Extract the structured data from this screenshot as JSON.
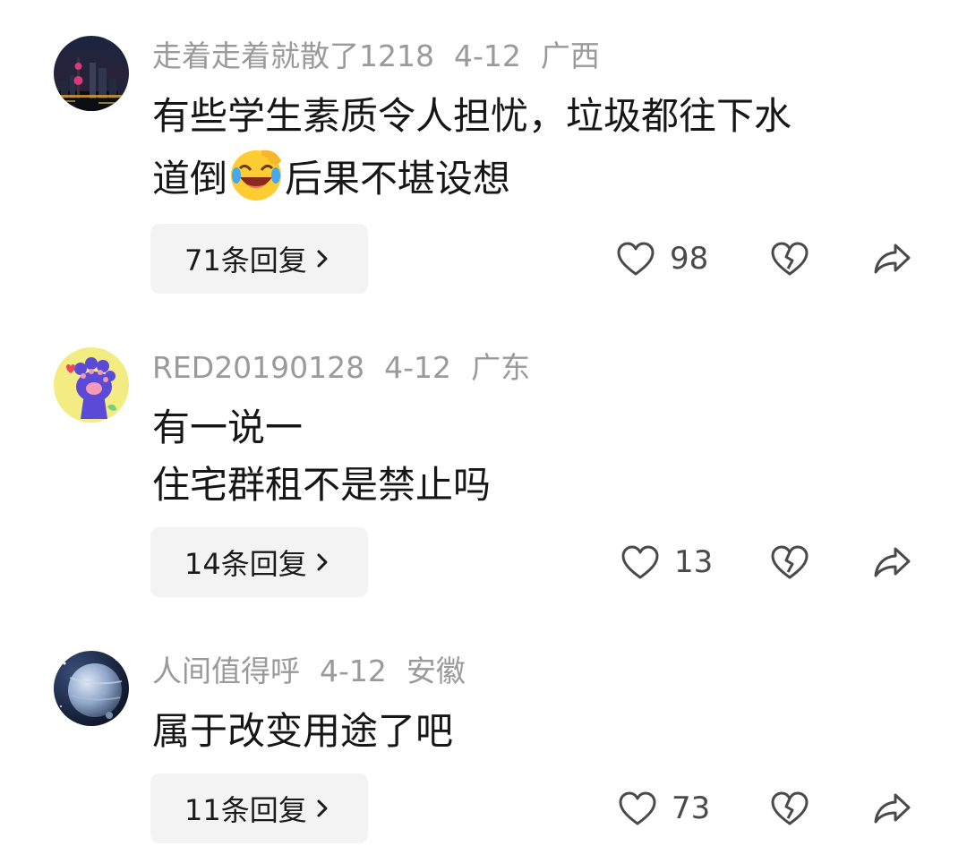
{
  "comments": [
    {
      "username": "走着走着就散了1218",
      "date": "4-12",
      "location": "广西",
      "text_lines": [
        "有些学生素质令人担忧，垃圾都往下水",
        "道倒",
        "后果不堪设想"
      ],
      "replies_label": "71条回复",
      "likes": "98",
      "avatar_icon": "city-night-skyline-avatar",
      "emoji_icon": "laughing-tears-emoji"
    },
    {
      "username": "RED20190128",
      "date": "4-12",
      "location": "广东",
      "text_lines": [
        "有一说一",
        "住宅群租不是禁止吗"
      ],
      "replies_label": "14条回复",
      "likes": "13",
      "avatar_icon": "cat-paw-avatar"
    },
    {
      "username": "人间值得呼",
      "date": "4-12",
      "location": "安徽",
      "text_lines": [
        "属于改变用途了吧"
      ],
      "replies_label": "11条回复",
      "likes": "73",
      "avatar_icon": "planet-space-avatar"
    }
  ],
  "icons": {
    "like": "heart-outline-icon",
    "dislike": "broken-heart-icon",
    "share": "share-arrow-icon",
    "chevron": "chevron-right-icon"
  },
  "colors": {
    "meta_text": "#9a9a9a",
    "reply_bg": "#f3f3f3",
    "icon_stroke": "#4a4a4a"
  }
}
